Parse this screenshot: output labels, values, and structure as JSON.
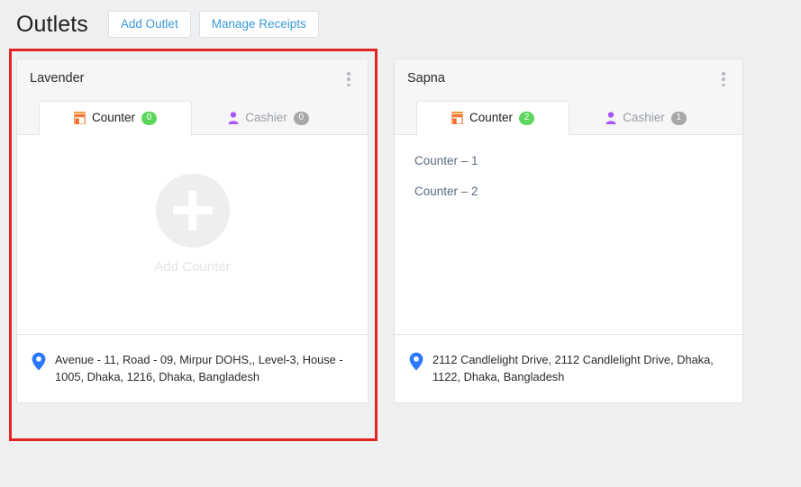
{
  "header": {
    "title": "Outlets",
    "buttons": [
      {
        "label": "Add Outlet",
        "name": "add-outlet-button"
      },
      {
        "label": "Manage Receipts",
        "name": "manage-receipts-button"
      }
    ]
  },
  "colors": {
    "page_background": "#eeeff1",
    "card_background": "#ffffff",
    "card_header_background": "#f6f6f7",
    "link_blue": "#3a9ad9",
    "highlight_red": "#e02524",
    "badge_green": "#5cd65c",
    "badge_grey": "#a8a8a8",
    "counter_icon_orange": "#f26a21",
    "cashier_icon_purple": "#a855f7",
    "pin_blue": "#2979ff",
    "counter_link": "#5c6a7e",
    "add_counter_label": "#e4e4e4"
  },
  "outlets": [
    {
      "name": "Lavender",
      "menu_icon": "kebab-menu-icon",
      "tabs": [
        {
          "label": "Counter",
          "count": "0",
          "icon": "shop-counter-icon",
          "active": true,
          "badge_style": "green"
        },
        {
          "label": "Cashier",
          "count": "0",
          "icon": "cashier-user-icon",
          "active": false,
          "badge_style": "grey"
        }
      ],
      "counters": [],
      "empty_state": {
        "label": "Add Counter",
        "icon": "plus-icon"
      },
      "address": "Avenue - 11, Road - 09, Mirpur DOHS,, Level-3, House - 1005, Dhaka, 1216, Dhaka, Bangladesh",
      "address_icon": "map-pin-icon"
    },
    {
      "name": "Sapna",
      "menu_icon": "kebab-menu-icon",
      "tabs": [
        {
          "label": "Counter",
          "count": "2",
          "icon": "shop-counter-icon",
          "active": true,
          "badge_style": "green"
        },
        {
          "label": "Cashier",
          "count": "1",
          "icon": "cashier-user-icon",
          "active": false,
          "badge_style": "grey"
        }
      ],
      "counters": [
        "Counter  – 1",
        "Counter  – 2"
      ],
      "empty_state": null,
      "address": "2112 Candlelight Drive, 2112 Candlelight Drive, Dhaka, 1122, Dhaka, Bangladesh",
      "address_icon": "map-pin-icon"
    }
  ],
  "highlight": {
    "name": "selection-highlight-box",
    "visible": true
  }
}
